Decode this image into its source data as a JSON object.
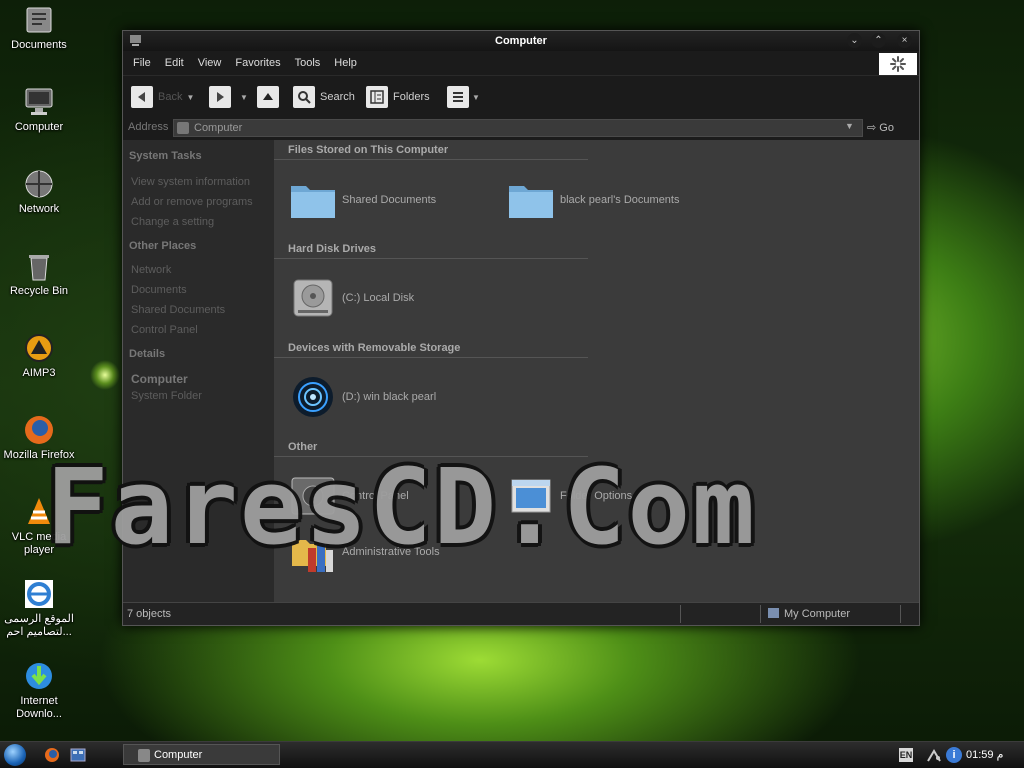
{
  "desktop": {
    "icons": [
      {
        "label": "Documents",
        "icon": "documents-icon"
      },
      {
        "label": "Computer",
        "icon": "computer-icon"
      },
      {
        "label": "Network",
        "icon": "network-icon"
      },
      {
        "label": "Recycle Bin",
        "icon": "recycle-bin-icon"
      },
      {
        "label": "AIMP3",
        "icon": "aimp-icon"
      },
      {
        "label": "Mozilla Firefox",
        "icon": "firefox-icon"
      },
      {
        "label": "VLC media player",
        "icon": "vlc-icon"
      },
      {
        "label": "الموقع الرسمى لتصاميم احم...",
        "icon": "internet-explorer-icon"
      },
      {
        "label": "Internet Downlo...",
        "icon": "internet-download-manager-icon"
      }
    ]
  },
  "window": {
    "title": "Computer",
    "menu": [
      "File",
      "Edit",
      "View",
      "Favorites",
      "Tools",
      "Help"
    ],
    "toolbar": {
      "back": "Back",
      "search": "Search",
      "folders": "Folders"
    },
    "address": {
      "label": "Address",
      "value": "Computer",
      "go": "Go"
    },
    "taskpane": {
      "system_tasks": {
        "title": "System Tasks",
        "items": [
          "View system information",
          "Add or remove programs",
          "Change a setting"
        ]
      },
      "other_places": {
        "title": "Other Places",
        "items": [
          "Network",
          "Documents",
          "Shared Documents",
          "Control Panel"
        ]
      },
      "details": {
        "title": "Details",
        "name": "Computer",
        "type": "System Folder"
      }
    },
    "groups": {
      "files": {
        "title": "Files Stored on This Computer",
        "items": [
          "Shared Documents",
          "black pearl's Documents"
        ]
      },
      "hdd": {
        "title": "Hard Disk Drives",
        "items": [
          "(C:) Local Disk"
        ]
      },
      "removable": {
        "title": "Devices with Removable Storage",
        "items": [
          "(D:) win black pearl"
        ]
      },
      "other": {
        "title": "Other",
        "items": [
          "Control Panel",
          "Folder Options",
          "Administrative Tools"
        ]
      }
    },
    "status": {
      "count": "7 objects",
      "location": "My Computer"
    }
  },
  "watermark": "FaresCD.Com",
  "taskbar": {
    "task_label": "Computer",
    "lang": "EN",
    "clock": "01:59 م"
  },
  "colors": {
    "window_bg": "#2b2b2b",
    "main_pane": "#3b3b3b",
    "folder_blue": "#8fc3ea",
    "accent_green": "#6fb22a"
  }
}
